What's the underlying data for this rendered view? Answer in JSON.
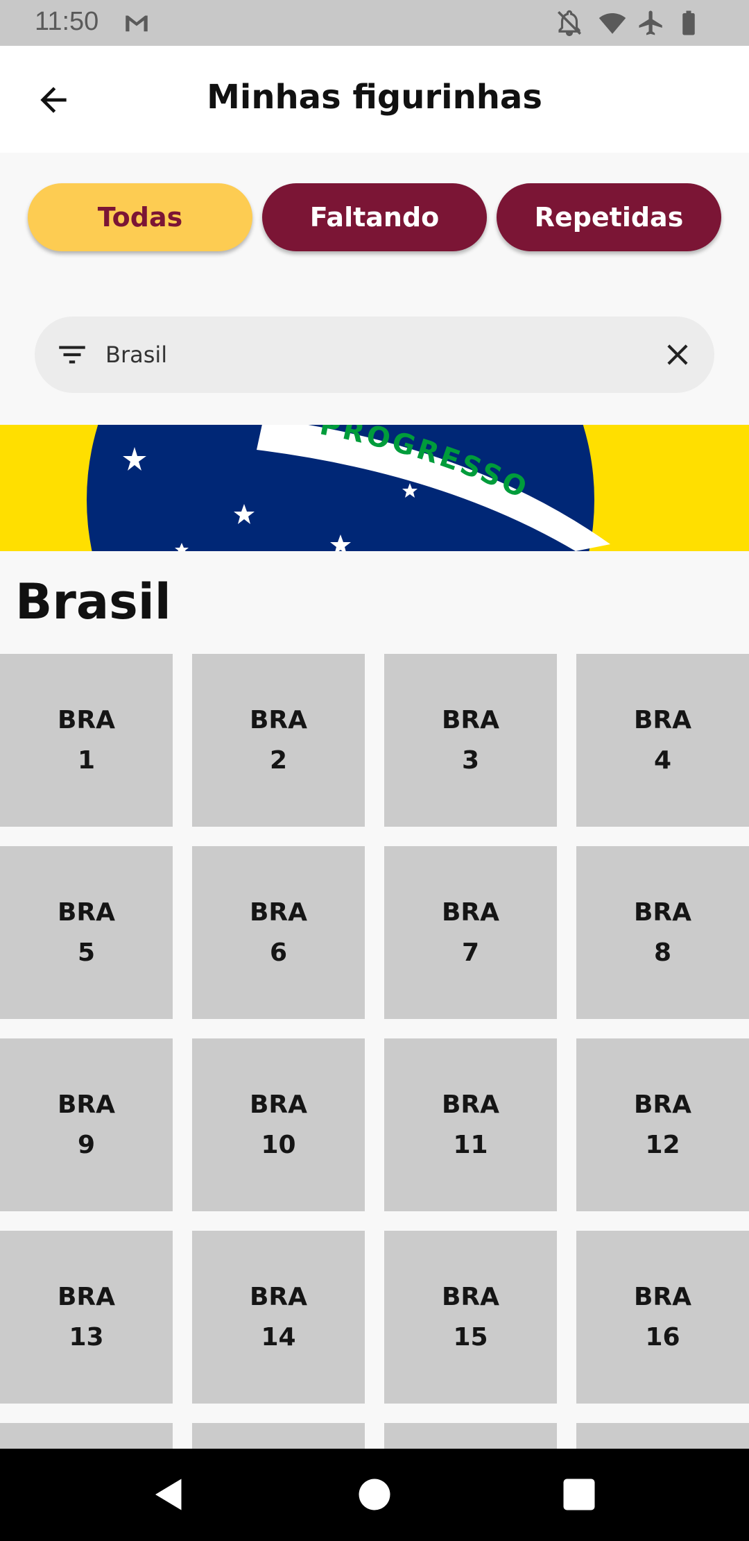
{
  "status_bar": {
    "time": "11:50",
    "icons": [
      "gmail-icon",
      "notifications-off-icon",
      "wifi-icon",
      "airplane-mode-icon",
      "battery-icon"
    ]
  },
  "app_bar": {
    "back_icon": "arrow-back-icon",
    "title": "Minhas figurinhas"
  },
  "filter_tabs": [
    {
      "label": "Todas",
      "active": true
    },
    {
      "label": "Faltando",
      "active": false
    },
    {
      "label": "Repetidas",
      "active": false
    }
  ],
  "search": {
    "filter_icon": "filter-list-icon",
    "value": "Brasil",
    "clear_icon": "close-icon"
  },
  "banner": {
    "flag": "brazil-flag",
    "motto_fragment": "PROGRESSO"
  },
  "section": {
    "title": "Brasil",
    "stickers": [
      {
        "code": "BRA",
        "number": "1"
      },
      {
        "code": "BRA",
        "number": "2"
      },
      {
        "code": "BRA",
        "number": "3"
      },
      {
        "code": "BRA",
        "number": "4"
      },
      {
        "code": "BRA",
        "number": "5"
      },
      {
        "code": "BRA",
        "number": "6"
      },
      {
        "code": "BRA",
        "number": "7"
      },
      {
        "code": "BRA",
        "number": "8"
      },
      {
        "code": "BRA",
        "number": "9"
      },
      {
        "code": "BRA",
        "number": "10"
      },
      {
        "code": "BRA",
        "number": "11"
      },
      {
        "code": "BRA",
        "number": "12"
      },
      {
        "code": "BRA",
        "number": "13"
      },
      {
        "code": "BRA",
        "number": "14"
      },
      {
        "code": "BRA",
        "number": "15"
      },
      {
        "code": "BRA",
        "number": "16"
      }
    ]
  },
  "colors": {
    "primary": "#7b1535",
    "accent": "#fdcc52",
    "sticker_bg": "#cbcbcb",
    "flag_green": "#009c3b",
    "flag_yellow": "#ffdf00",
    "flag_blue": "#002776"
  },
  "nav_bar": {
    "icons": [
      "back-nav-icon",
      "home-nav-icon",
      "recents-nav-icon"
    ]
  }
}
